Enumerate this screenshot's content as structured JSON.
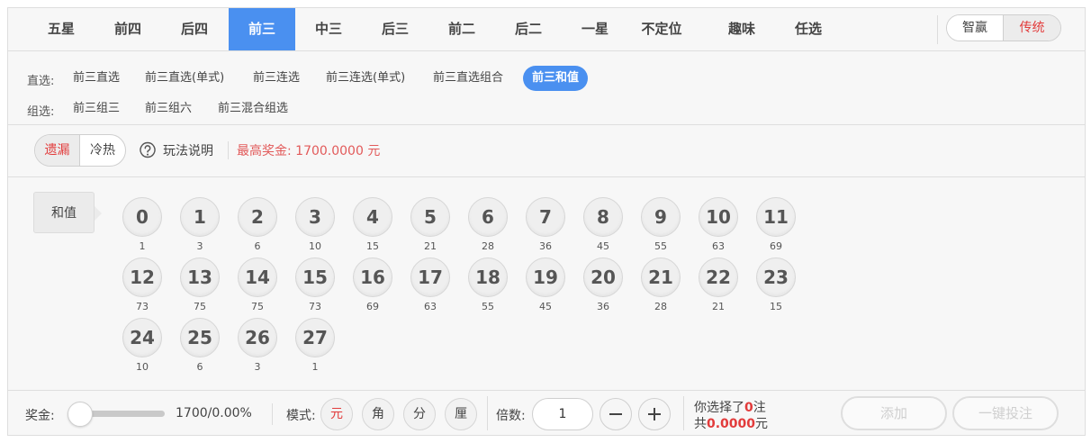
{
  "top_tabs": [
    "五星",
    "前四",
    "后四",
    "前三",
    "中三",
    "后三",
    "前二",
    "后二",
    "一星",
    "不定位",
    "趣味",
    "任选"
  ],
  "mode_toggle": {
    "zhiying": "智赢",
    "chuantong": "传统"
  },
  "subtabs": {
    "zhixuan_label": "直选:",
    "zhixuan_items": [
      "前三直选",
      "前三直选(单式)",
      "前三连选",
      "前三连选(单式)",
      "前三直选组合",
      "前三和值"
    ],
    "zuxuan_label": "组选:",
    "zuxuan_items": [
      "前三组三",
      "前三组六",
      "前三混合组选"
    ]
  },
  "infobar": {
    "miss_label": "遗漏",
    "hot_cold_label": "冷热",
    "help_label": "玩法说明",
    "max_prize": "最高奖金: 1700.0000 元"
  },
  "sum_label": "和值",
  "balls": [
    {
      "number": "0",
      "miss": "1"
    },
    {
      "number": "1",
      "miss": "3"
    },
    {
      "number": "2",
      "miss": "6"
    },
    {
      "number": "3",
      "miss": "10"
    },
    {
      "number": "4",
      "miss": "15"
    },
    {
      "number": "5",
      "miss": "21"
    },
    {
      "number": "6",
      "miss": "28"
    },
    {
      "number": "7",
      "miss": "36"
    },
    {
      "number": "8",
      "miss": "45"
    },
    {
      "number": "9",
      "miss": "55"
    },
    {
      "number": "10",
      "miss": "63"
    },
    {
      "number": "11",
      "miss": "69"
    },
    {
      "number": "12",
      "miss": "73"
    },
    {
      "number": "13",
      "miss": "75"
    },
    {
      "number": "14",
      "miss": "75"
    },
    {
      "number": "15",
      "miss": "73"
    },
    {
      "number": "16",
      "miss": "69"
    },
    {
      "number": "17",
      "miss": "63"
    },
    {
      "number": "18",
      "miss": "55"
    },
    {
      "number": "19",
      "miss": "45"
    },
    {
      "number": "20",
      "miss": "36"
    },
    {
      "number": "21",
      "miss": "28"
    },
    {
      "number": "22",
      "miss": "21"
    },
    {
      "number": "23",
      "miss": "15"
    },
    {
      "number": "24",
      "miss": "10"
    },
    {
      "number": "25",
      "miss": "6"
    },
    {
      "number": "26",
      "miss": "3"
    },
    {
      "number": "27",
      "miss": "1"
    }
  ],
  "bottom": {
    "prize_label": "奖金:",
    "prize_value": "1700/0.00%",
    "mode_label": "模式:",
    "units": [
      "元",
      "角",
      "分",
      "厘"
    ],
    "multiple_label": "倍数:",
    "multiple_value": "1",
    "selected_prefix": "你选择了",
    "selected_count": "0",
    "selected_suffix": "注",
    "total_prefix": "共",
    "total_amount": "0.0000",
    "total_suffix": "元",
    "add_label": "添加",
    "one_click_label": "一键投注"
  }
}
